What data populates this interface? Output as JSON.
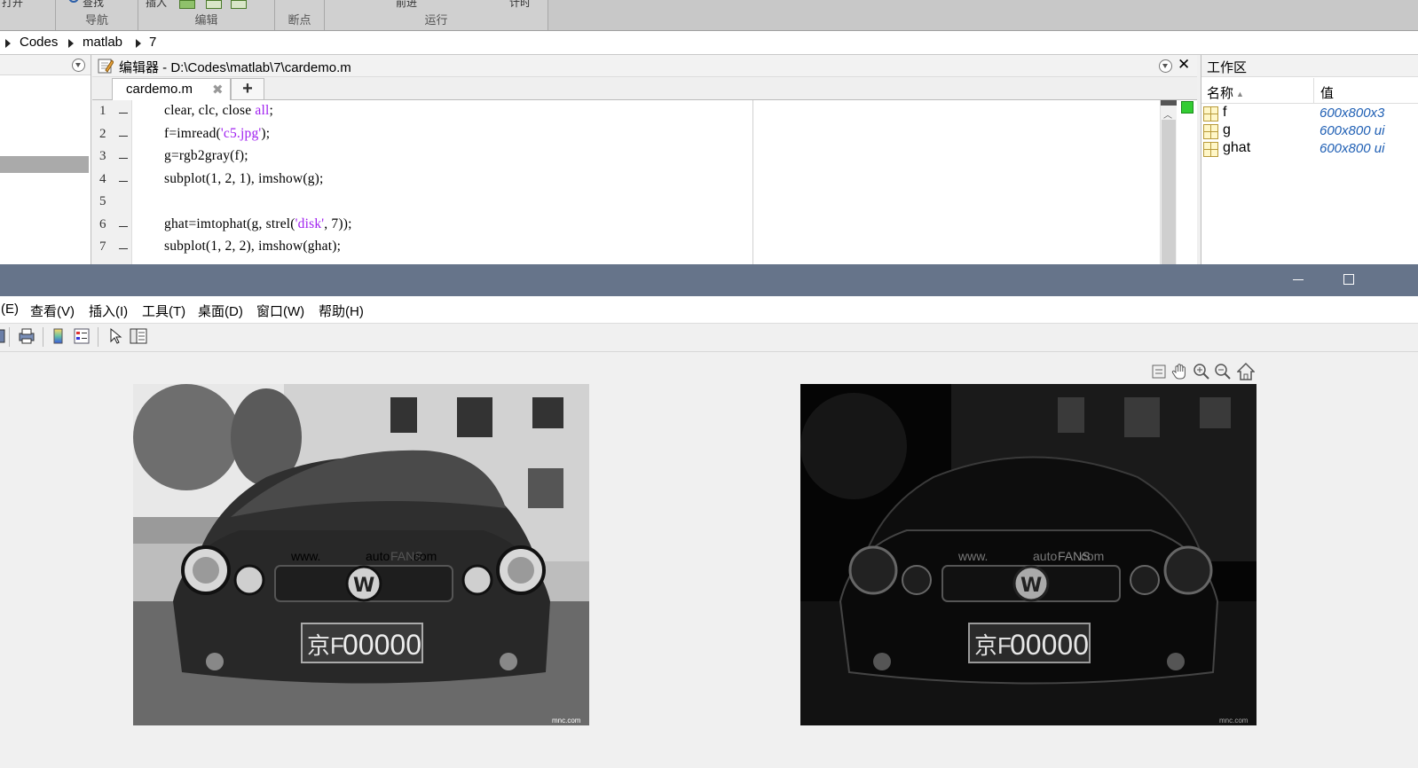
{
  "ribbon": {
    "sections": [
      {
        "label": "导航"
      },
      {
        "label": "编辑"
      },
      {
        "label": "断点"
      },
      {
        "label": "运行"
      }
    ],
    "top_cut_texts": [
      "打开",
      "查找",
      "插入",
      "前进",
      "计时"
    ]
  },
  "address": {
    "crumbs": [
      "Codes",
      "matlab",
      "7"
    ]
  },
  "editor": {
    "title": "编辑器 - D:\\Codes\\matlab\\7\\cardemo.m",
    "tab_label": "cardemo.m",
    "new_tab_label": "+",
    "lines": [
      {
        "num": "1",
        "has_dash": true,
        "pre": "clear, clc, close ",
        "str": "all",
        "post": ";"
      },
      {
        "num": "2",
        "has_dash": true,
        "pre": "f=imread(",
        "str": "'c5.jpg'",
        "post": ");"
      },
      {
        "num": "3",
        "has_dash": true,
        "pre": "g=rgb2gray(f);",
        "str": "",
        "post": ""
      },
      {
        "num": "4",
        "has_dash": true,
        "pre": "subplot(1, 2, 1), imshow(g);",
        "str": "",
        "post": ""
      },
      {
        "num": "5",
        "has_dash": false,
        "pre": "",
        "str": "",
        "post": ""
      },
      {
        "num": "6",
        "has_dash": true,
        "pre": "ghat=imtophat(g, strel(",
        "str": "'disk'",
        "post": ", 7));"
      },
      {
        "num": "7",
        "has_dash": true,
        "pre": "subplot(1, 2, 2), imshow(ghat);",
        "str": "",
        "post": ""
      }
    ],
    "colors": {
      "string": "#a020f0",
      "status_ok": "#33cc33"
    }
  },
  "workspace": {
    "title": "工作区",
    "col_name": "名称",
    "col_value": "值",
    "vars": [
      {
        "name": "f",
        "value": "600x800x3"
      },
      {
        "name": "g",
        "value": "600x800 ui"
      },
      {
        "name": "ghat",
        "value": "600x800 ui"
      }
    ]
  },
  "figure": {
    "title_bar_color": "#66748a",
    "menu": [
      "(E)",
      "查看(V)",
      "插入(I)",
      "工具(T)",
      "桌面(D)",
      "窗口(W)",
      "帮助(H)"
    ],
    "toolbar_icons": [
      "save-icon",
      "print-icon",
      "colorbar-icon",
      "legend-icon",
      "pointer-icon",
      "property-editor-icon"
    ],
    "axes_toolbar_icons": [
      "export-icon",
      "pan-hand-icon",
      "zoom-in-icon",
      "zoom-out-icon",
      "home-icon"
    ],
    "images": [
      {
        "name": "grayscale-car",
        "text_site": "www.",
        "text_auto": "auto",
        "text_fans": "FANS",
        "text_com": ".com",
        "plate_prefix": "京F",
        "plate_num": "00000",
        "watermark": "mnc.com"
      },
      {
        "name": "tophat-car",
        "text_site": "www.",
        "text_auto": "auto",
        "text_fans": "FANS",
        "text_com": ".com",
        "plate_prefix": "京F",
        "plate_num": "00000",
        "watermark": "mnc.com"
      }
    ]
  }
}
